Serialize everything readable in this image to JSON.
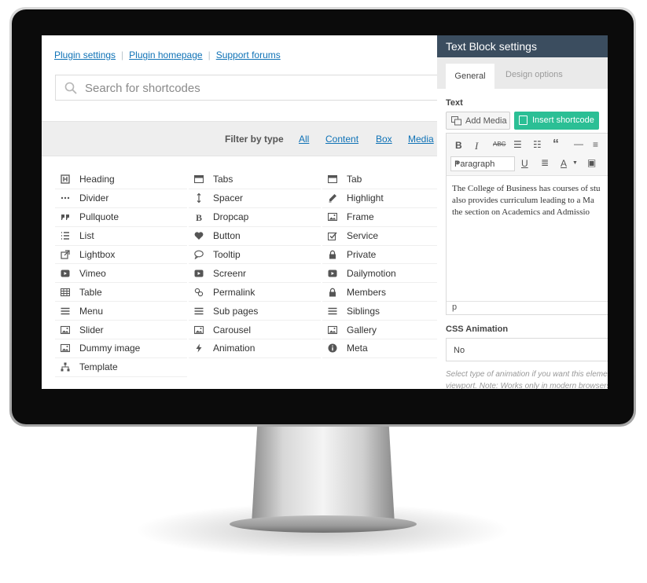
{
  "links": {
    "plugin_settings": "Plugin settings",
    "plugin_homepage": "Plugin homepage",
    "support_forums": "Support forums",
    "separator": "|"
  },
  "search": {
    "placeholder": "Search for shortcodes"
  },
  "filter": {
    "label": "Filter by type",
    "options": [
      "All",
      "Content",
      "Box",
      "Media"
    ]
  },
  "shortcodes": {
    "col1": [
      {
        "label": "Heading",
        "icon": "heading-icon"
      },
      {
        "label": "Divider",
        "icon": "divider-icon"
      },
      {
        "label": "Pullquote",
        "icon": "quote-icon"
      },
      {
        "label": "List",
        "icon": "list-icon"
      },
      {
        "label": "Lightbox",
        "icon": "external-link-icon"
      },
      {
        "label": "Vimeo",
        "icon": "video-icon"
      },
      {
        "label": "Table",
        "icon": "table-icon"
      },
      {
        "label": "Menu",
        "icon": "menu-icon"
      },
      {
        "label": "Slider",
        "icon": "image-icon"
      },
      {
        "label": "Dummy image",
        "icon": "image-icon"
      },
      {
        "label": "Template",
        "icon": "sitemap-icon"
      }
    ],
    "col2": [
      {
        "label": "Tabs",
        "icon": "tabs-icon"
      },
      {
        "label": "Spacer",
        "icon": "spacer-icon"
      },
      {
        "label": "Dropcap",
        "icon": "bold-icon"
      },
      {
        "label": "Button",
        "icon": "heart-icon"
      },
      {
        "label": "Tooltip",
        "icon": "comment-icon"
      },
      {
        "label": "Screenr",
        "icon": "video-icon"
      },
      {
        "label": "Permalink",
        "icon": "link-icon"
      },
      {
        "label": "Sub pages",
        "icon": "menu-icon"
      },
      {
        "label": "Carousel",
        "icon": "image-icon"
      },
      {
        "label": "Animation",
        "icon": "bolt-icon"
      }
    ],
    "col3": [
      {
        "label": "Tab",
        "icon": "tab-icon"
      },
      {
        "label": "Highlight",
        "icon": "pencil-icon"
      },
      {
        "label": "Frame",
        "icon": "image-icon"
      },
      {
        "label": "Service",
        "icon": "check-icon"
      },
      {
        "label": "Private",
        "icon": "lock-icon"
      },
      {
        "label": "Dailymotion",
        "icon": "video-icon"
      },
      {
        "label": "Members",
        "icon": "lock-icon"
      },
      {
        "label": "Siblings",
        "icon": "menu-icon"
      },
      {
        "label": "Gallery",
        "icon": "image-icon"
      },
      {
        "label": "Meta",
        "icon": "info-icon"
      }
    ]
  },
  "panel": {
    "title": "Text Block settings",
    "tabs": {
      "general": "General",
      "design": "Design options"
    },
    "text_label": "Text",
    "add_media": "Add Media",
    "insert_shortcode": "Insert shortcode",
    "format_select": "Paragraph",
    "content_lines": [
      "The College of Business has courses of stu",
      "also provides curriculum leading to a Ma",
      "the section on Academics and Admissio"
    ],
    "status_path": "p",
    "css_animation_label": "CSS Animation",
    "css_animation_value": "No",
    "help_lines": [
      "Select type of animation if you want this elemen",
      "viewport. Note: Works only in modern browsers"
    ]
  },
  "colors": {
    "link": "#0f72b6",
    "panel_header": "#3b4d5f",
    "insert_button": "#2bbf95",
    "bezel": "#0b0b0b"
  }
}
